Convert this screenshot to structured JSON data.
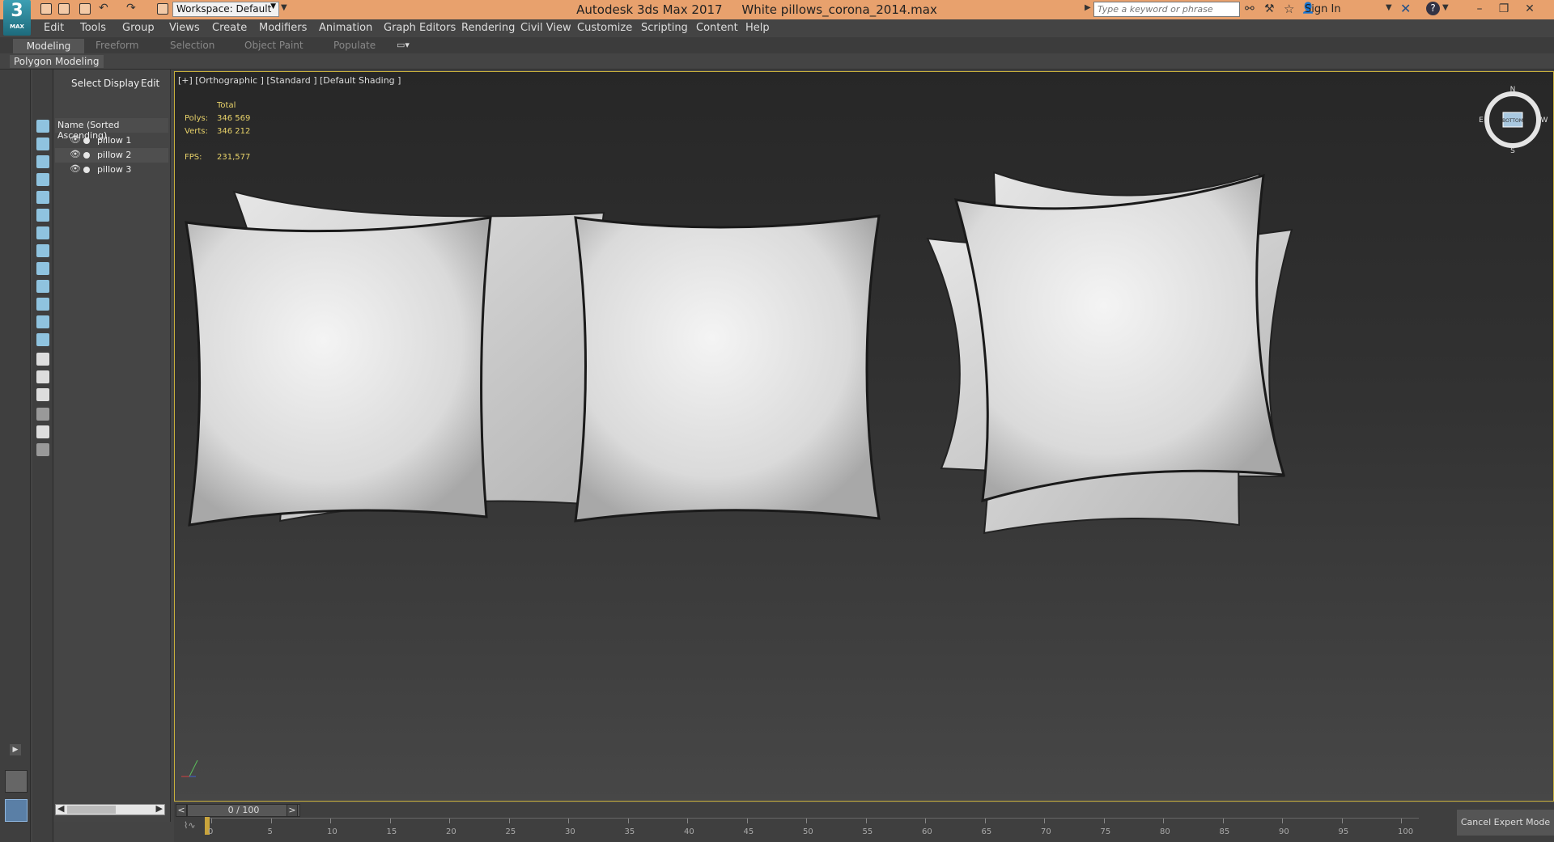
{
  "app": {
    "logo_main": "3",
    "logo_sub": "MAX",
    "title": "Autodesk 3ds Max 2017",
    "filename": "White pillows_corona_2014.max",
    "workspace": "Workspace: Default",
    "search_placeholder": "Type a keyword or phrase",
    "sign_in": "Sign In"
  },
  "menu": [
    "Edit",
    "Tools",
    "Group",
    "Views",
    "Create",
    "Modifiers",
    "Animation",
    "Graph Editors",
    "Rendering",
    "Civil View",
    "Customize",
    "Scripting",
    "Content",
    "Help"
  ],
  "ribbon": {
    "tabs": [
      "Modeling",
      "Freeform",
      "Selection",
      "Object Paint",
      "Populate"
    ],
    "panel": "Polygon Modeling"
  },
  "scene_explorer": {
    "tabs": [
      "Select",
      "Display",
      "Edit"
    ],
    "header": "Name (Sorted Ascending)",
    "items": [
      "pillow 1",
      "pillow 2",
      "pillow 3"
    ]
  },
  "viewport": {
    "label": "[+] [Orthographic ] [Standard ] [Default Shading ]",
    "stats": {
      "total_label": "Total",
      "polys_label": "Polys:",
      "polys": "346 569",
      "verts_label": "Verts:",
      "verts": "346 212",
      "fps_label": "FPS:",
      "fps": "231,577"
    },
    "viewcube": {
      "face": "BOTTOM",
      "north": "N",
      "west": "E",
      "east": "W",
      "south": "S"
    }
  },
  "timeline": {
    "frame": "0 / 100",
    "prev": "<",
    "next": ">",
    "ticks": [
      "0",
      "5",
      "10",
      "15",
      "20",
      "25",
      "30",
      "35",
      "40",
      "45",
      "50",
      "55",
      "60",
      "65",
      "70",
      "75",
      "80",
      "85",
      "90",
      "95",
      "100"
    ],
    "cancel_expert": "Cancel Expert Mode"
  },
  "colors": {
    "title_bar": "#e8a16d",
    "viewport_border": "#c9b03c",
    "stats_text": "#e9d36a",
    "icon_blue": "#8fc3df"
  }
}
